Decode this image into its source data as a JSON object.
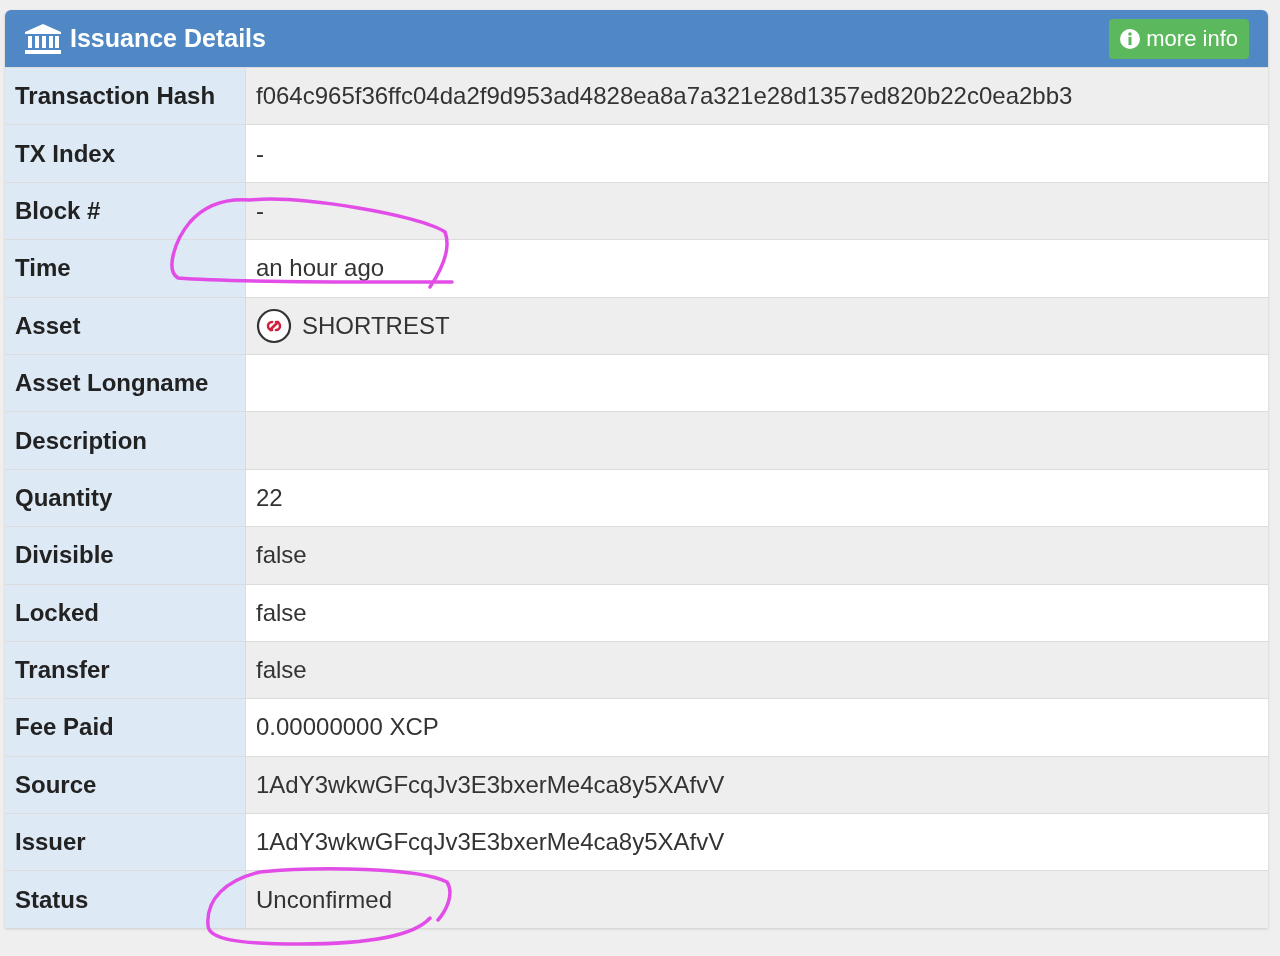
{
  "panel": {
    "title": "Issuance Details",
    "more_info_button": "more info"
  },
  "rows": [
    {
      "kind": "text",
      "label": "Transaction Hash",
      "value": "f064c965f36ffc04da2f9d953ad4828ea8a7a321e28d1357ed820b22c0ea2bb3"
    },
    {
      "kind": "text",
      "label": "TX Index",
      "value": "-"
    },
    {
      "kind": "text",
      "label": "Block #",
      "value": "-"
    },
    {
      "kind": "text",
      "label": "Time",
      "value": "an hour ago"
    },
    {
      "kind": "asset",
      "label": "Asset",
      "value": "SHORTREST"
    },
    {
      "kind": "text",
      "label": "Asset Longname"
    },
    {
      "kind": "text",
      "label": "Description"
    },
    {
      "kind": "text",
      "label": "Quantity",
      "value": "22"
    },
    {
      "kind": "text",
      "label": "Divisible",
      "value": "false"
    },
    {
      "kind": "text",
      "label": "Locked",
      "value": "false"
    },
    {
      "kind": "text",
      "label": "Transfer",
      "value": "false"
    },
    {
      "kind": "text",
      "label": "Fee Paid",
      "value": "0.00000000 XCP"
    },
    {
      "kind": "text",
      "label": "Source",
      "value": "1AdY3wkwGFcqJv3E3bxerMe4ca8y5XAfvV"
    },
    {
      "kind": "text",
      "label": "Issuer",
      "value": "1AdY3wkwGFcqJv3E3bxerMe4ca8y5XAfvV"
    },
    {
      "kind": "text",
      "label": "Status",
      "value": "Unconfirmed"
    }
  ]
}
